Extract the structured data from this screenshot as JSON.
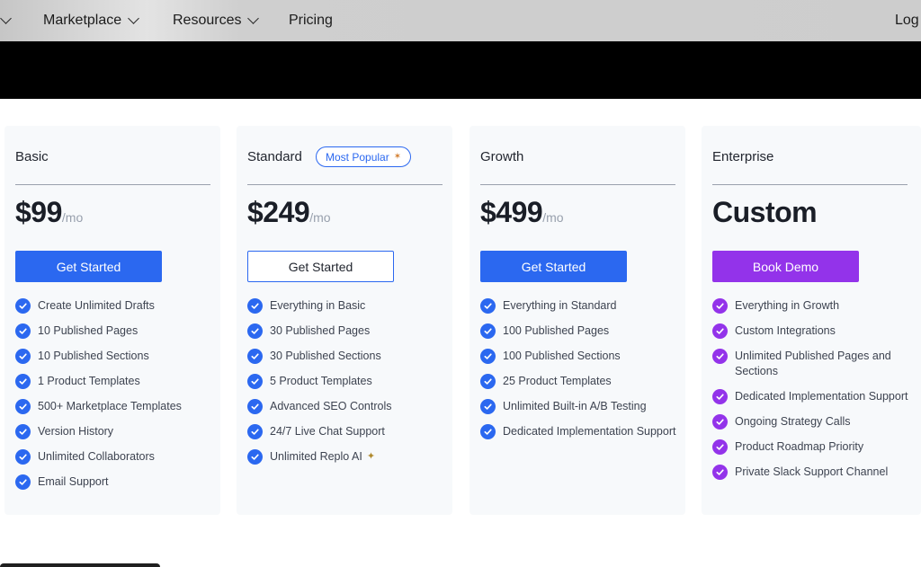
{
  "nav": {
    "items": [
      {
        "label": "Marketplace"
      },
      {
        "label": "Resources"
      },
      {
        "label": "Pricing"
      }
    ],
    "login_partial": "Log"
  },
  "plans": [
    {
      "name": "Basic",
      "price": "$99",
      "period": "/mo",
      "cta": "Get Started",
      "features": [
        "Create Unlimited Drafts",
        "10 Published Pages",
        "10 Published Sections",
        "1 Product Templates",
        "500+ Marketplace Templates",
        "Version History",
        "Unlimited Collaborators",
        "Email Support"
      ]
    },
    {
      "name": "Standard",
      "badge": "Most Popular",
      "price": "$249",
      "period": "/mo",
      "cta": "Get Started",
      "features": [
        "Everything in Basic",
        "30 Published Pages",
        "30 Published Sections",
        "5 Product Templates",
        "Advanced SEO Controls",
        "24/7 Live Chat Support",
        "Unlimited Replo AI"
      ]
    },
    {
      "name": "Growth",
      "price": "$499",
      "period": "/mo",
      "cta": "Get Started",
      "features": [
        "Everything in Standard",
        "100 Published Pages",
        "100 Published Sections",
        "25 Product Templates",
        "Unlimited Built-in A/B Testing",
        "Dedicated Implementation Support"
      ]
    },
    {
      "name": "Enterprise",
      "price": "Custom",
      "cta": "Book Demo",
      "features": [
        "Everything in Growth",
        "Custom Integrations",
        "Unlimited Published Pages and Sections",
        "Dedicated Implementation Support",
        "Ongoing Strategy Calls",
        "Product Roadmap Priority",
        "Private Slack Support Channel"
      ]
    }
  ],
  "colors": {
    "primary_blue": "#2b68f0",
    "enterprise_purple": "#9333ea",
    "card_bg": "#f7f9fb"
  },
  "icons": {
    "feature_check": "check-circle-icon",
    "nav_dropdown": "chevron-down-icon",
    "badge_decoration": "party-popper-icon",
    "ai_decoration": "magic-wand-icon"
  }
}
